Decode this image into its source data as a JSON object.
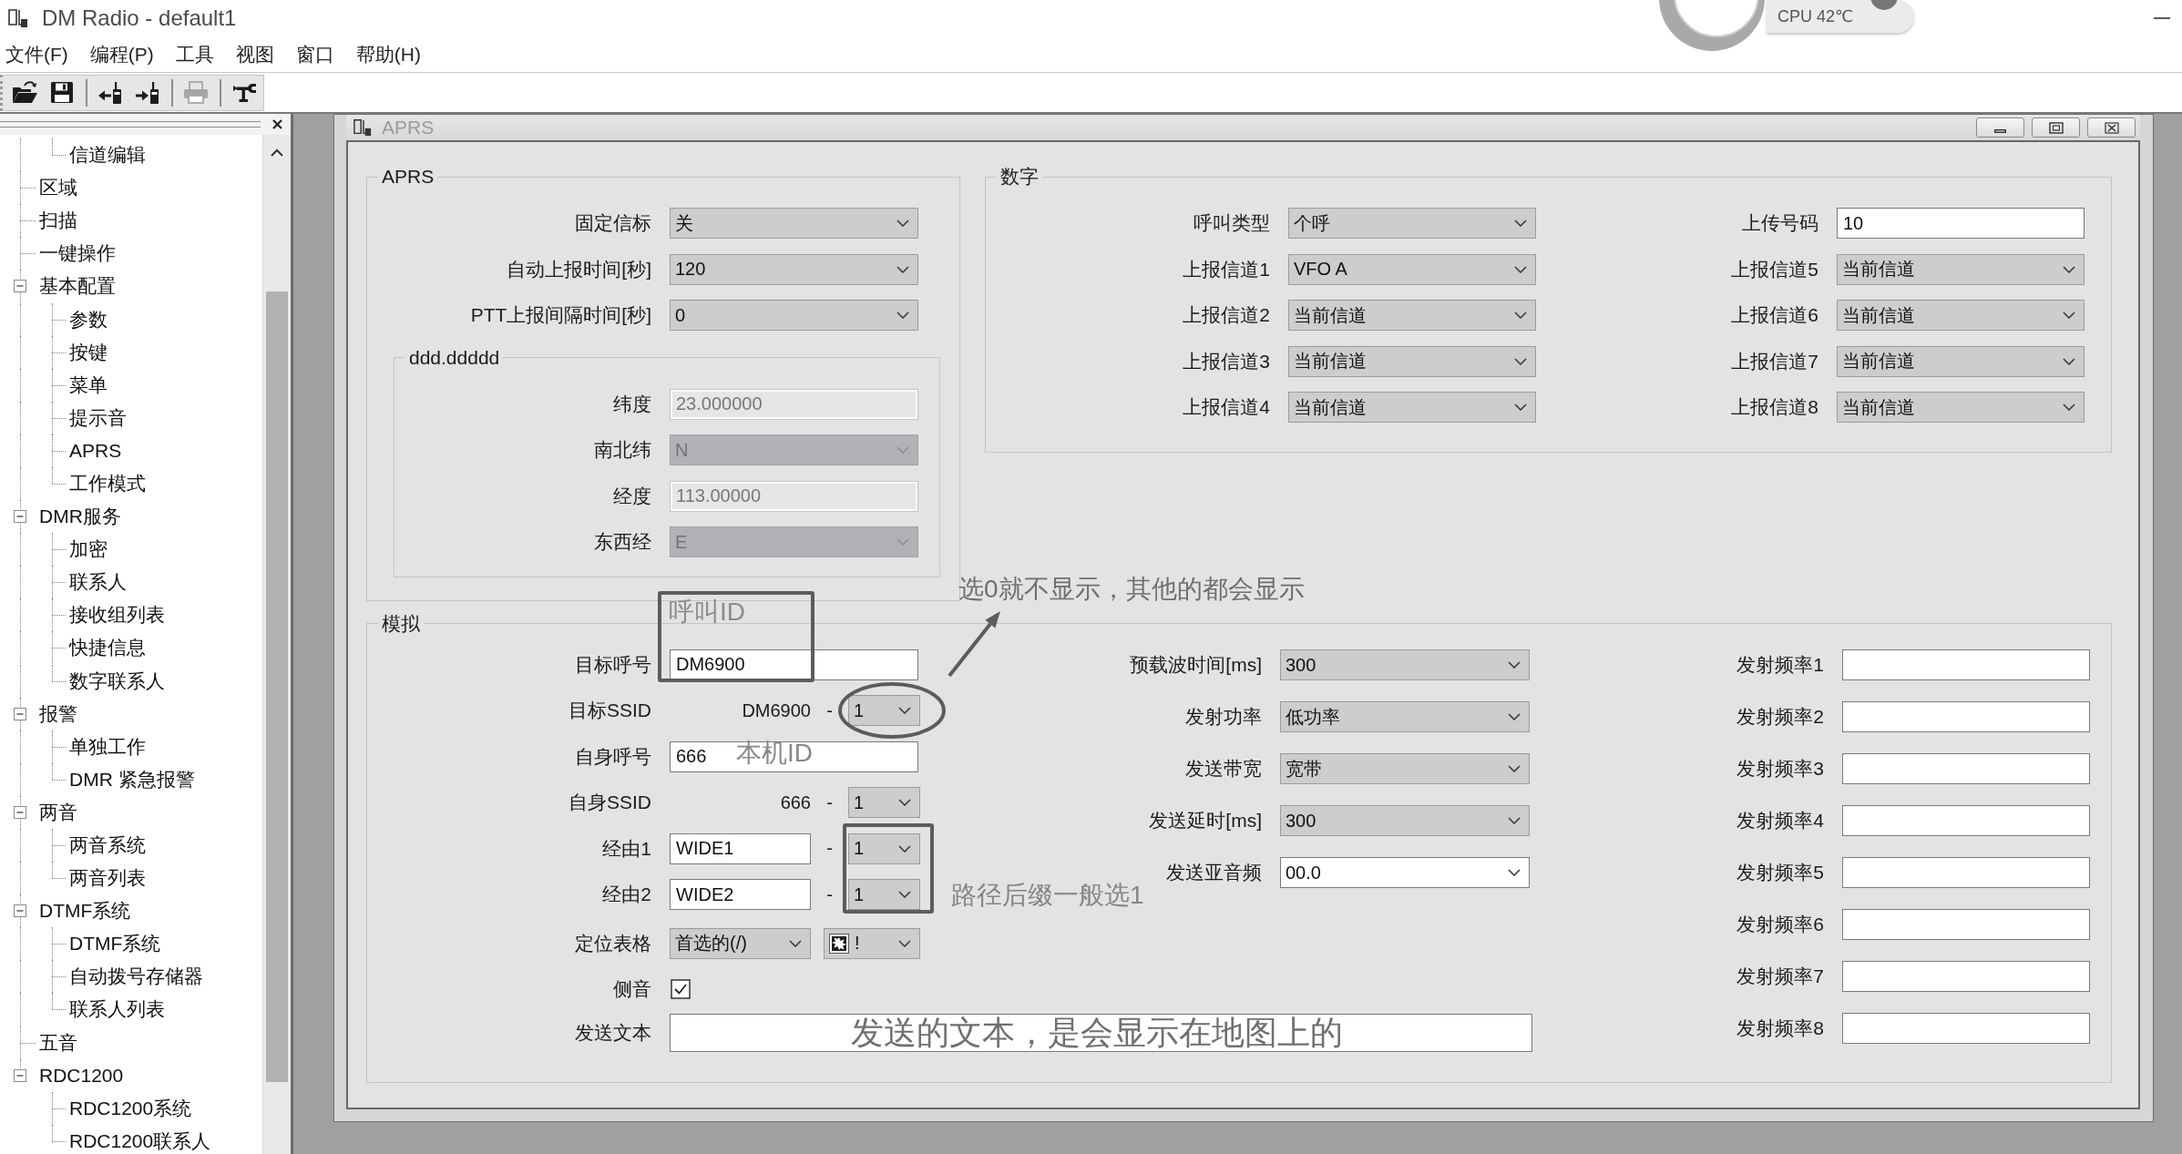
{
  "window": {
    "title": "DM Radio - default1"
  },
  "cpu_widget": {
    "text": "CPU 42℃"
  },
  "menu": [
    "文件(F)",
    "编程(P)",
    "工具",
    "视图",
    "窗口",
    "帮助(H)"
  ],
  "toolbar": {
    "groups": [
      {
        "buttons": [
          {
            "kind": "open",
            "disabled": false
          },
          {
            "kind": "save",
            "disabled": false
          }
        ]
      },
      {
        "buttons": [
          {
            "kind": "read_radio",
            "disabled": false
          },
          {
            "kind": "write_radio",
            "disabled": false
          }
        ]
      },
      {
        "buttons": [
          {
            "kind": "print",
            "disabled": true
          }
        ]
      },
      {
        "buttons": [
          {
            "kind": "tool",
            "disabled": false
          }
        ]
      }
    ]
  },
  "sidebar": {
    "tree": [
      {
        "children": [
          {
            "label": "信道编辑"
          }
        ]
      },
      {
        "label": "区域"
      },
      {
        "label": "扫描"
      },
      {
        "label": "一键操作"
      },
      {
        "label": "基本配置",
        "expanded": true,
        "children": [
          {
            "label": "参数"
          },
          {
            "label": "按键"
          },
          {
            "label": "菜单"
          },
          {
            "label": "提示音"
          },
          {
            "label": "APRS"
          },
          {
            "label": "工作模式"
          }
        ]
      },
      {
        "label": "DMR服务",
        "expanded": true,
        "children": [
          {
            "label": "加密"
          },
          {
            "label": "联系人"
          },
          {
            "label": "接收组列表"
          },
          {
            "label": "快捷信息"
          },
          {
            "label": "数字联系人"
          }
        ]
      },
      {
        "label": "报警",
        "expanded": true,
        "children": [
          {
            "label": "单独工作"
          },
          {
            "label": "DMR 紧急报警"
          }
        ]
      },
      {
        "label": "两音",
        "expanded": true,
        "children": [
          {
            "label": "两音系统"
          },
          {
            "label": "两音列表"
          }
        ]
      },
      {
        "label": "DTMF系统",
        "expanded": true,
        "children": [
          {
            "label": "DTMF系统"
          },
          {
            "label": "自动拨号存储器"
          },
          {
            "label": "联系人列表"
          }
        ]
      },
      {
        "label": "五音"
      },
      {
        "label": "RDC1200",
        "expanded": true,
        "children": [
          {
            "label": "RDC1200系统"
          },
          {
            "label": "RDC1200联系人"
          }
        ]
      }
    ]
  },
  "child_window": {
    "title": "APRS",
    "aprs_group": {
      "title": "APRS",
      "fields": [
        {
          "kind": "select",
          "label": "固定信标",
          "value": "关"
        },
        {
          "kind": "select",
          "label": "自动上报时间[秒]",
          "value": "120"
        },
        {
          "kind": "select",
          "label": "PTT上报间隔时间[秒]",
          "value": "0"
        }
      ],
      "coordinates": {
        "title": "ddd.ddddd",
        "fields": [
          {
            "kind": "text",
            "label": "纬度",
            "value": "23.000000",
            "disabled": true
          },
          {
            "kind": "select",
            "label": "南北纬",
            "value": "N",
            "disabled": true
          },
          {
            "kind": "text",
            "label": "经度",
            "value": "113.00000",
            "disabled": true
          },
          {
            "kind": "select",
            "label": "东西经",
            "value": "E",
            "disabled": true
          }
        ]
      }
    },
    "digital_group": {
      "title": "数字",
      "left_fields": [
        {
          "kind": "select",
          "label": "呼叫类型",
          "value": "个呼"
        },
        {
          "kind": "select",
          "label": "上报信道1",
          "value": "VFO A"
        },
        {
          "kind": "select",
          "label": "上报信道2",
          "value": "当前信道"
        },
        {
          "kind": "select",
          "label": "上报信道3",
          "value": "当前信道"
        },
        {
          "kind": "select",
          "label": "上报信道4",
          "value": "当前信道"
        }
      ],
      "right_fields": [
        {
          "kind": "text",
          "label": "上传号码",
          "value": "10"
        },
        {
          "kind": "select",
          "label": "上报信道5",
          "value": "当前信道"
        },
        {
          "kind": "select",
          "label": "上报信道6",
          "value": "当前信道"
        },
        {
          "kind": "select",
          "label": "上报信道7",
          "value": "当前信道"
        },
        {
          "kind": "select",
          "label": "上报信道8",
          "value": "当前信道"
        }
      ]
    },
    "analog_group": {
      "title": "模拟",
      "left_fields": [
        {
          "kind": "text",
          "label": "目标呼号",
          "value": "DM6900"
        },
        {
          "kind": "ssid",
          "label": "目标SSID",
          "prefix": "DM6900",
          "separator": "-",
          "value": "1"
        },
        {
          "kind": "text",
          "label": "自身呼号",
          "value": "666"
        },
        {
          "kind": "ssid",
          "label": "自身SSID",
          "prefix": "666",
          "separator": "-",
          "value": "1"
        },
        {
          "kind": "route",
          "label": "经由1",
          "value": "WIDE1",
          "separator": "-",
          "suffix": "1"
        },
        {
          "kind": "route",
          "label": "经由2",
          "value": "WIDE2",
          "separator": "-",
          "suffix": "1"
        },
        {
          "kind": "symbol",
          "label": "定位表格",
          "value": "首选的(/)",
          "symbol": "!"
        },
        {
          "kind": "checkbox",
          "label": "侧音",
          "checked": true
        }
      ],
      "middle_fields": [
        {
          "kind": "select",
          "label": "预载波时间[ms]",
          "value": "300"
        },
        {
          "kind": "select",
          "label": "发射功率",
          "value": "低功率"
        },
        {
          "kind": "select",
          "label": "发送带宽",
          "value": "宽带"
        },
        {
          "kind": "select",
          "label": "发送延时[ms]",
          "value": "300"
        },
        {
          "kind": "combo",
          "label": "发送亚音频",
          "value": "00.0"
        }
      ],
      "right_fields": [
        {
          "kind": "text",
          "label": "发射频率1"
        },
        {
          "kind": "text",
          "label": "发射频率2"
        },
        {
          "kind": "text",
          "label": "发射频率3"
        },
        {
          "kind": "text",
          "label": "发射频率4"
        },
        {
          "kind": "text",
          "label": "发射频率5"
        },
        {
          "kind": "text",
          "label": "发射频率6"
        },
        {
          "kind": "text",
          "label": "发射频率7"
        },
        {
          "kind": "text",
          "label": "发射频率8"
        }
      ],
      "send_text": {
        "kind": "text",
        "label": "发送文本",
        "annotation": "发送的文本，是会显示在地图上的"
      }
    }
  },
  "annotations": [
    {
      "kind": "frame"
    },
    {
      "kind": "note",
      "text": "呼叫ID"
    },
    {
      "kind": "ellipse"
    },
    {
      "kind": "arrow"
    },
    {
      "kind": "note",
      "text": "选0就不显示，其他的都会显示"
    },
    {
      "kind": "note",
      "text": "本机ID"
    },
    {
      "kind": "frame"
    },
    {
      "kind": "note",
      "text": "路径后缀一般选1"
    }
  ]
}
